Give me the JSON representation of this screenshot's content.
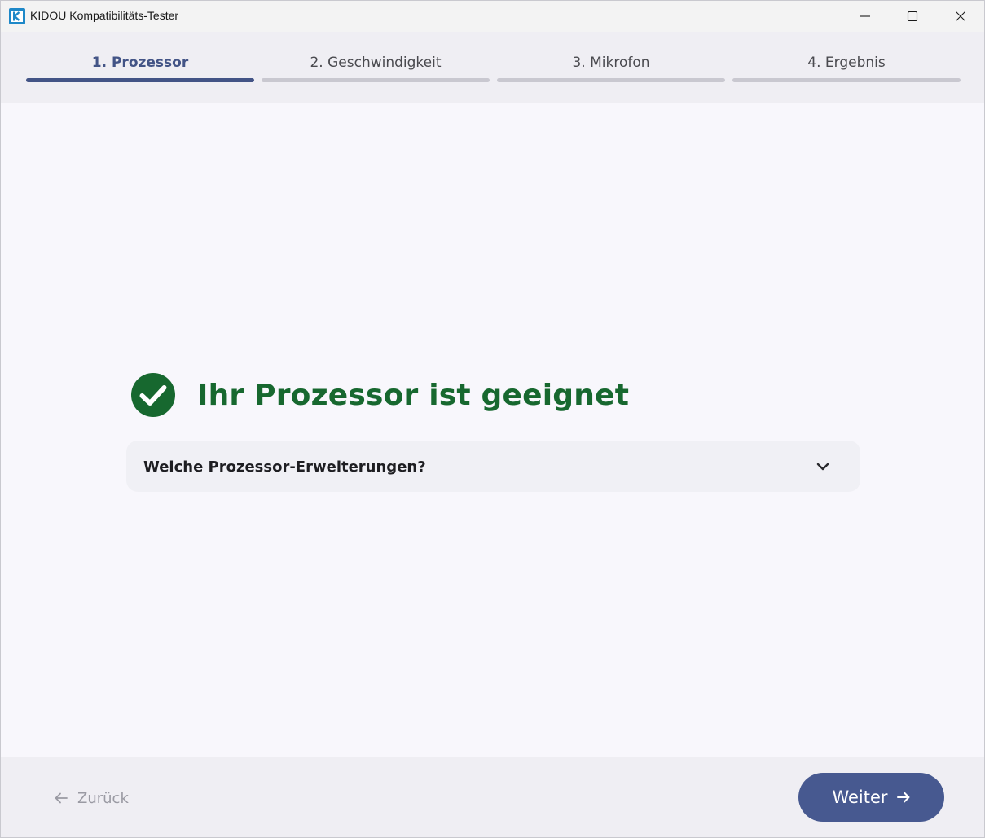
{
  "window": {
    "title": "KIDOU Kompatibilitäts-Tester",
    "app_icon": "kidou-logo-icon",
    "controls": [
      "minimize-icon",
      "maximize-icon",
      "close-icon"
    ]
  },
  "steps": [
    {
      "label": "1. Prozessor",
      "active": true
    },
    {
      "label": "2. Geschwindigkeit",
      "active": false
    },
    {
      "label": "3. Mikrofon",
      "active": false
    },
    {
      "label": "4. Ergebnis",
      "active": false
    }
  ],
  "result": {
    "icon": "check-circle-icon",
    "title": "Ihr Prozessor ist geeignet",
    "color": "#17682f"
  },
  "accordion": {
    "label": "Welche Prozessor-Erweiterungen?",
    "icon": "chevron-down-icon",
    "expanded": false
  },
  "footer": {
    "back_label": "Zurück",
    "back_icon": "arrow-left-icon",
    "next_label": "Weiter",
    "next_icon": "arrow-right-icon",
    "accent": "#475990"
  }
}
